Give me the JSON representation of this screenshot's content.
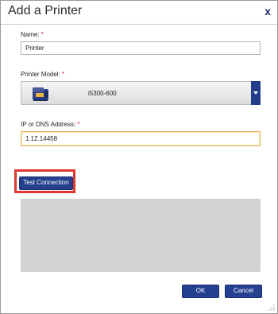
{
  "dialog": {
    "title": "Add a Printer",
    "close_label": "x"
  },
  "name_field": {
    "label": "Name:",
    "required_mark": "*",
    "value": "Printer"
  },
  "model_field": {
    "label": "Printer Model:",
    "required_mark": "*",
    "selected_model": "i5300-600",
    "icon": "printer-icon"
  },
  "address_field": {
    "label": "IP or DNS Address:",
    "required_mark": "*",
    "value": "1.12.14458"
  },
  "buttons": {
    "test_connection": "Test Connection",
    "ok": "OK",
    "cancel": "Cancel"
  },
  "colors": {
    "accent": "#25408f",
    "highlight": "#e03530",
    "focus_border": "#e2b756"
  }
}
